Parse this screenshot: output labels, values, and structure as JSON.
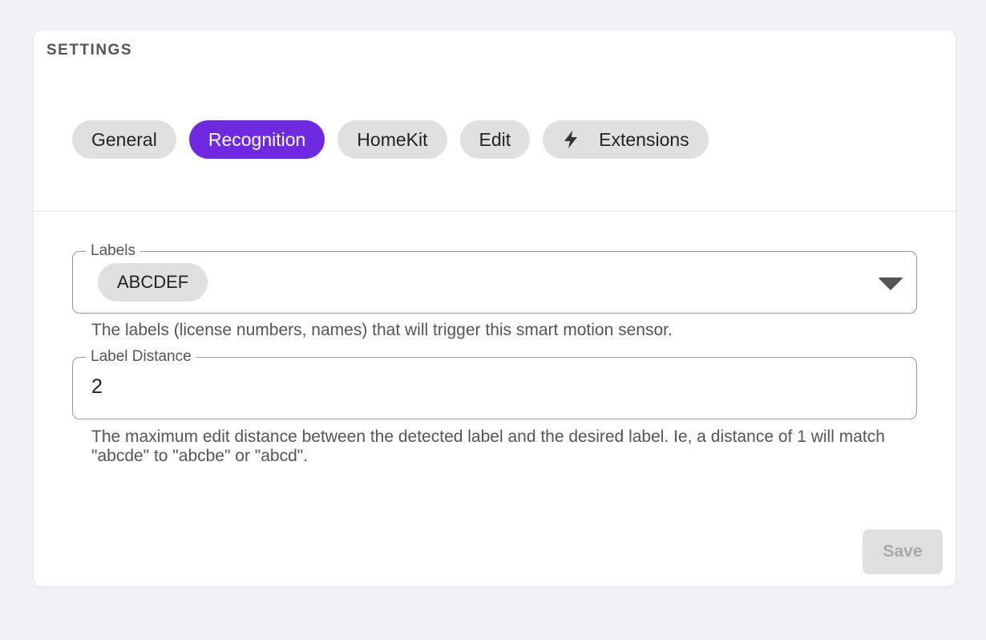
{
  "settings": {
    "title": "SETTINGS",
    "tabs": [
      {
        "label": "General",
        "active": false
      },
      {
        "label": "Recognition",
        "active": true
      },
      {
        "label": "HomeKit",
        "active": false
      },
      {
        "label": "Edit",
        "active": false
      },
      {
        "label": "Extensions",
        "active": false,
        "icon": "lightning-bolt-icon"
      }
    ],
    "labels_field": {
      "legend": "Labels",
      "chips": [
        "ABCDEF"
      ],
      "helper": "The labels (license numbers, names) that will trigger this smart motion sensor."
    },
    "distance_field": {
      "legend": "Label Distance",
      "value": "2",
      "helper": "The maximum edit distance between the detected label and the desired label. Ie, a distance of 1 will match \"abcde\" to \"abcbe\" or \"abcd\"."
    },
    "save_label": "Save"
  },
  "colors": {
    "accent": "#6e2ae0",
    "tab_bg": "#e0e0e0",
    "page_bg": "#f1f2f6"
  }
}
